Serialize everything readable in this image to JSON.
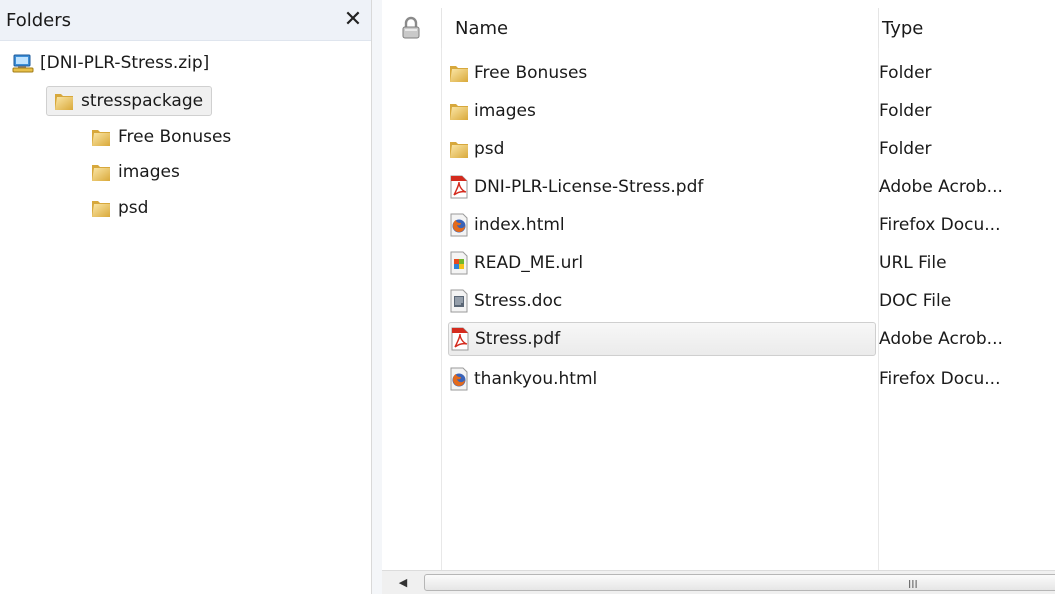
{
  "folders_pane": {
    "title": "Folders",
    "close_glyph": "✕",
    "tree": [
      {
        "label": "[DNI-PLR-Stress.zip]",
        "icon": "zip-archive-icon",
        "level": 0
      },
      {
        "label": "stresspackage",
        "icon": "folder-icon",
        "level": 1,
        "selected": true
      },
      {
        "label": "Free Bonuses",
        "icon": "folder-icon",
        "level": 2
      },
      {
        "label": "images",
        "icon": "folder-icon",
        "level": 2
      },
      {
        "label": "psd",
        "icon": "folder-icon",
        "level": 2
      }
    ]
  },
  "file_list": {
    "columns": {
      "lock_icon": "lock-icon",
      "name": "Name",
      "type": "Type"
    },
    "files": [
      {
        "name": "Free Bonuses",
        "type": "Folder",
        "icon": "folder-icon"
      },
      {
        "name": "images",
        "type": "Folder",
        "icon": "folder-icon"
      },
      {
        "name": "psd",
        "type": "Folder",
        "icon": "folder-icon"
      },
      {
        "name": "DNI-PLR-License-Stress.pdf",
        "type": "Adobe Acrob...",
        "icon": "pdf-icon"
      },
      {
        "name": "index.html",
        "type": "Firefox Docu...",
        "icon": "firefox-document-icon"
      },
      {
        "name": "READ_ME.url",
        "type": "URL File",
        "icon": "url-file-icon"
      },
      {
        "name": "Stress.doc",
        "type": "DOC File",
        "icon": "doc-file-icon"
      },
      {
        "name": "Stress.pdf",
        "type": "Adobe Acrob...",
        "icon": "pdf-icon",
        "selected": true
      },
      {
        "name": "thankyou.html",
        "type": "Firefox Docu...",
        "icon": "firefox-document-icon"
      }
    ]
  },
  "scrollbar": {
    "left_arrow": "◀",
    "grip": "III"
  },
  "colors": {
    "folder": "#e9c25a",
    "pdf_red": "#d42b1e",
    "firefox_blue": "#3a63b8",
    "selection_border": "#cfcfcf"
  }
}
